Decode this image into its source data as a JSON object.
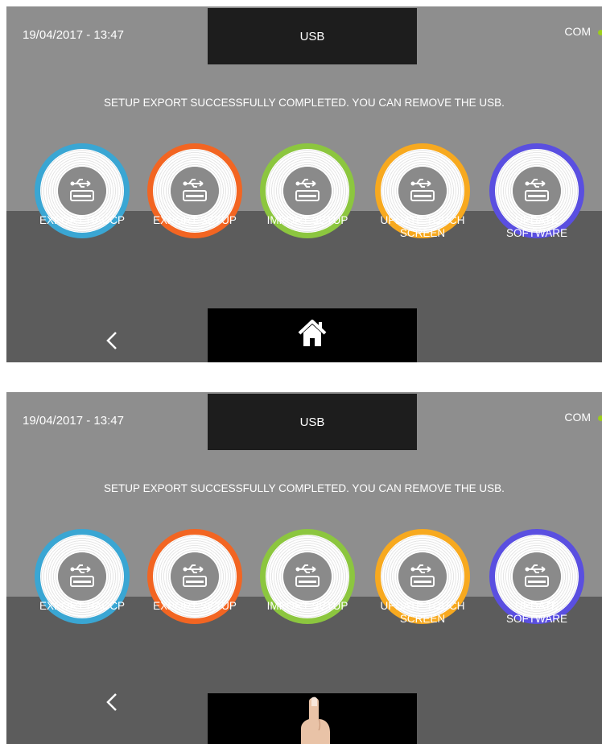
{
  "header": {
    "datetime": "19/04/2017 - 13:47",
    "title": "USB",
    "status_label": "COM",
    "status_color": "#9ccc1c"
  },
  "message": "SETUP EXPORT SUCCESSFULLY COMPLETED. YOU CAN REMOVE THE USB.",
  "buttons": [
    {
      "label_line1": "EXPORT HACCP",
      "label_line2": "",
      "ring_color": "#3aa6d3",
      "icon": "usb-icon"
    },
    {
      "label_line1": "EXPORT SETUP",
      "label_line2": "",
      "ring_color": "#f26522",
      "icon": "usb-icon"
    },
    {
      "label_line1": "IMPORT SETUP",
      "label_line2": "",
      "ring_color": "#8cc63f",
      "icon": "usb-icon"
    },
    {
      "label_line1": "UPDATE TOUCH",
      "label_line2": "SCREEN",
      "ring_color": "#f7a91f",
      "icon": "usb-icon"
    },
    {
      "label_line1": "UPDATE",
      "label_line2": "SOFTWARE",
      "ring_color": "#5a4fe0",
      "icon": "usb-icon"
    }
  ],
  "nav": {
    "back_icon": "chevron-left-icon",
    "home_icon": "home-icon"
  },
  "overlay": {
    "second_panel_icon": "finger-pointer"
  }
}
